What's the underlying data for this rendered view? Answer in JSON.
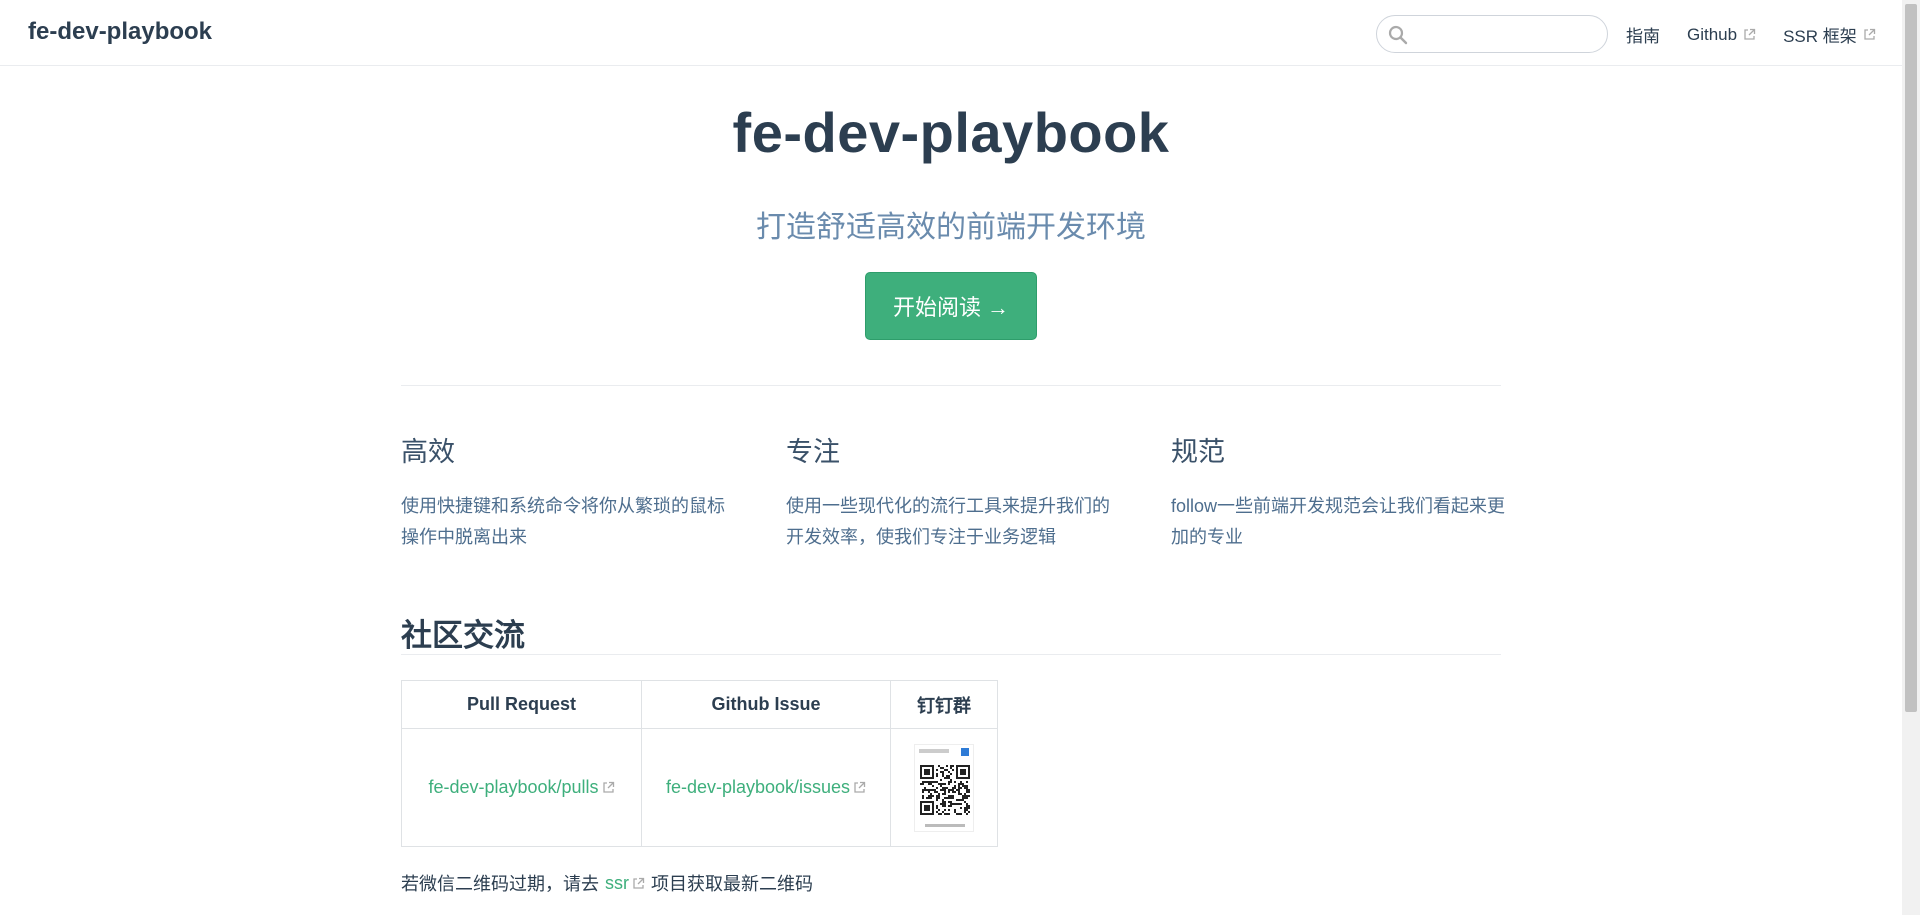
{
  "navbar": {
    "site_name": "fe-dev-playbook",
    "search_placeholder": "",
    "links": [
      {
        "label": "指南"
      },
      {
        "label": "Github"
      },
      {
        "label": "SSR 框架"
      }
    ]
  },
  "hero": {
    "title": "fe-dev-playbook",
    "description": "打造舒适高效的前端开发环境",
    "action": "开始阅读 →"
  },
  "features": [
    {
      "title": "高效",
      "details": "使用快捷键和系统命令将你从繁琐的鼠标操作中脱离出来"
    },
    {
      "title": "专注",
      "details": "使用一些现代化的流行工具来提升我们的开发效率，使我们专注于业务逻辑"
    },
    {
      "title": "规范",
      "details": "follow一些前端开发规范会让我们看起来更加的专业"
    }
  ],
  "community": {
    "title": "社区交流",
    "headers": [
      "Pull Request",
      "Github Issue",
      "钉钉群"
    ],
    "cells": [
      "fe-dev-playbook/pulls",
      "fe-dev-playbook/issues"
    ],
    "footnote_before": "若微信二维码过期，请去",
    "footnote_link": "ssr",
    "footnote_after": "项目获取最新二维码"
  },
  "colors": {
    "accent": "#3eaf7c",
    "text": "#2c3e50",
    "subtext": "#6a8bad"
  },
  "icons": [
    "search-icon",
    "external-link-icon",
    "qr-code-icon"
  ]
}
